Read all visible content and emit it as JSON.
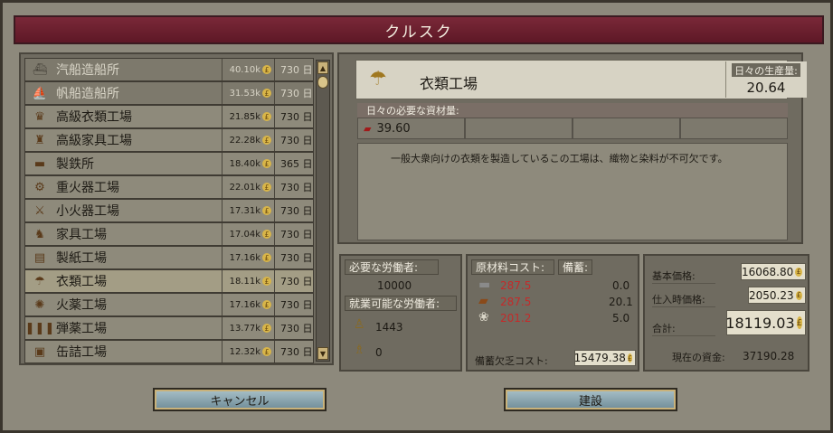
{
  "window": {
    "title": "クルスク"
  },
  "buildings": [
    {
      "name": "汽船造船所",
      "cost": "40.10k",
      "days": "730 日",
      "icon": "steamship-icon",
      "glyph": "⛴",
      "state": "disabled"
    },
    {
      "name": "帆船造船所",
      "cost": "31.53k",
      "days": "730 日",
      "icon": "sailship-icon",
      "glyph": "⛵",
      "state": "disabled"
    },
    {
      "name": "高級衣類工場",
      "cost": "21.85k",
      "days": "730 日",
      "icon": "luxury-clothes-icon",
      "glyph": "♛",
      "state": "normal"
    },
    {
      "name": "高級家具工場",
      "cost": "22.28k",
      "days": "730 日",
      "icon": "luxury-furniture-icon",
      "glyph": "♜",
      "state": "normal"
    },
    {
      "name": "製鉄所",
      "cost": "18.40k",
      "days": "365 日",
      "icon": "steel-icon",
      "glyph": "▬",
      "state": "normal"
    },
    {
      "name": "重火器工場",
      "cost": "22.01k",
      "days": "730 日",
      "icon": "artillery-icon",
      "glyph": "⚙",
      "state": "normal"
    },
    {
      "name": "小火器工場",
      "cost": "17.31k",
      "days": "730 日",
      "icon": "rifle-icon",
      "glyph": "⚔",
      "state": "normal"
    },
    {
      "name": "家具工場",
      "cost": "17.04k",
      "days": "730 日",
      "icon": "furniture-icon",
      "glyph": "♞",
      "state": "normal"
    },
    {
      "name": "製紙工場",
      "cost": "17.16k",
      "days": "730 日",
      "icon": "paper-icon",
      "glyph": "▤",
      "state": "normal"
    },
    {
      "name": "衣類工場",
      "cost": "18.11k",
      "days": "730 日",
      "icon": "clothes-icon",
      "glyph": "☂",
      "state": "selected"
    },
    {
      "name": "火薬工場",
      "cost": "17.16k",
      "days": "730 日",
      "icon": "explosives-icon",
      "glyph": "✺",
      "state": "normal"
    },
    {
      "name": "弾薬工場",
      "cost": "13.77k",
      "days": "730 日",
      "icon": "ammunition-icon",
      "glyph": "❚❚❚",
      "state": "normal"
    },
    {
      "name": "缶詰工場",
      "cost": "12.32k",
      "days": "730 日",
      "icon": "canned-food-icon",
      "glyph": "▣",
      "state": "normal"
    }
  ],
  "selected": {
    "name": "衣類工場",
    "production_label": "日々の生産量:",
    "production_value": "20.64",
    "needs_label": "日々の必要な資材量:",
    "need_value": "39.60",
    "description": "一般大衆向けの衣類を製造しているこの工場は、織物と染料が不可欠です。"
  },
  "workers": {
    "required_label": "必要な労働者:",
    "required_value": "10000",
    "available_label": "就業可能な労働者:",
    "available_1": "1443",
    "available_2": "0"
  },
  "costs": {
    "header_a": "原材料コスト:",
    "header_b": "備蓄:",
    "rows": [
      {
        "cost": "287.5",
        "stock": "0.0"
      },
      {
        "cost": "287.5",
        "stock": "20.1"
      },
      {
        "cost": "201.2",
        "stock": "5.0"
      }
    ],
    "shortage_label": "備蓄欠乏コスト:",
    "shortage_value": "15479.38"
  },
  "prices": {
    "base_label": "基本価格:",
    "base_value": "16068.80",
    "buy_label": "仕入時価格:",
    "buy_value": "2050.23",
    "total_label": "合計:",
    "total_value": "18119.03",
    "funds_label": "現在の資金:",
    "funds_value": "37190.28"
  },
  "buttons": {
    "cancel": "キャンセル",
    "build": "建設"
  },
  "colors": {
    "title_bar": "#6e1f2f",
    "red_cost": "#c42a2a",
    "coin": "#d8b548"
  }
}
